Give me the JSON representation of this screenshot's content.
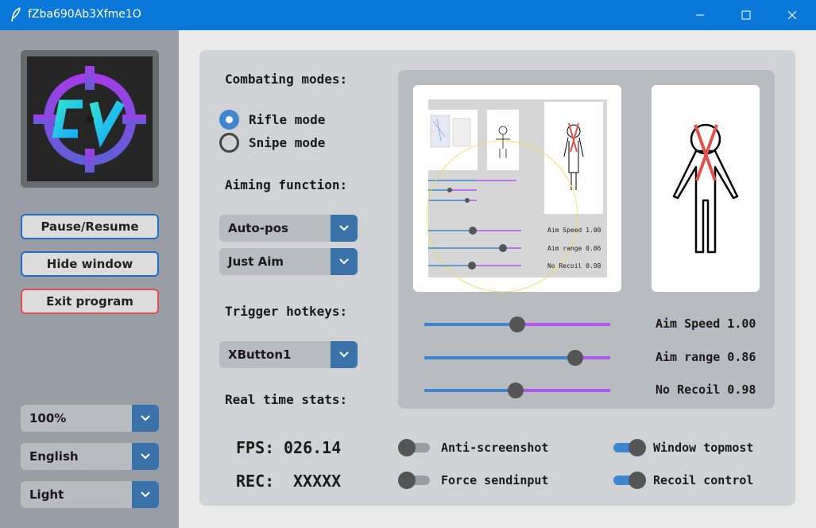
{
  "window": {
    "title": "fZba690Ab3Xfme1O"
  },
  "sidebar": {
    "buttons": {
      "pause": "Pause/Resume",
      "hide": "Hide window",
      "exit": "Exit program"
    },
    "dropdowns": {
      "zoom": "100%",
      "language": "English",
      "theme": "Light"
    }
  },
  "main": {
    "combat_heading": "Combating modes:",
    "modes": [
      {
        "label": "Rifle mode",
        "selected": true
      },
      {
        "label": "Snipe mode",
        "selected": false
      }
    ],
    "aim_heading": "Aiming function:",
    "aim_dropdowns": [
      "Auto-pos",
      "Just Aim"
    ],
    "trigger_heading": "Trigger hotkeys:",
    "trigger_dropdown": "XButton1",
    "stats_heading": "Real time stats:",
    "stats": {
      "fps_label": "FPS:",
      "fps_value": "026.14",
      "rec_label": "REC:",
      "rec_value": "XXXXX"
    }
  },
  "sliders": [
    {
      "label": "Aim Speed 1.00",
      "fraction": 0.5
    },
    {
      "label": "Aim range 0.86",
      "fraction": 0.81
    },
    {
      "label": "No Recoil 0.98",
      "fraction": 0.49
    }
  ],
  "toggles": [
    {
      "label": "Anti-screenshot",
      "on": false
    },
    {
      "label": "Force sendinput",
      "on": false
    },
    {
      "label": "Window topmost",
      "on": true
    },
    {
      "label": "Recoil control",
      "on": true
    }
  ],
  "preview": {
    "mini_sliders": [
      "Aim Speed 1.00",
      "Aim range 0.86",
      "No Recoil 0.98"
    ]
  },
  "logo": {
    "text": "CV"
  },
  "colors": {
    "accent": "#3e86cf",
    "slider_right": "#b356f0",
    "exit_border": "#e05050",
    "titlebar": "#0a78d7"
  },
  "icons": {
    "app": "feather-icon",
    "minimize": "minimize-icon",
    "maximize": "maximize-icon",
    "close": "close-icon",
    "dropdown": "chevron-down-icon"
  }
}
